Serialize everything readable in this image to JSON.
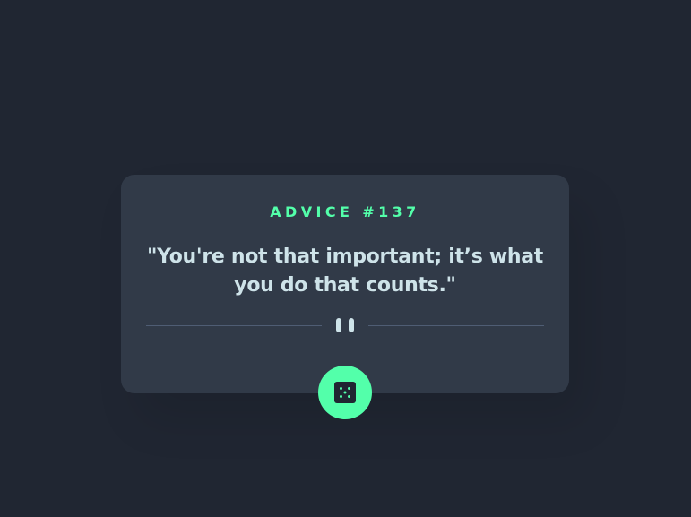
{
  "advice": {
    "id_label": "ADVICE #137",
    "text": "\"You're not that important; it’s what you do that counts.\""
  },
  "divider": {
    "icon": "pause-icon"
  },
  "dice_button": {
    "icon": "dice-icon"
  },
  "colors": {
    "background": "#202632",
    "card": "#313a48",
    "accent": "#53ffaa",
    "text": "#cee3e9",
    "divider": "#4f5d74"
  }
}
